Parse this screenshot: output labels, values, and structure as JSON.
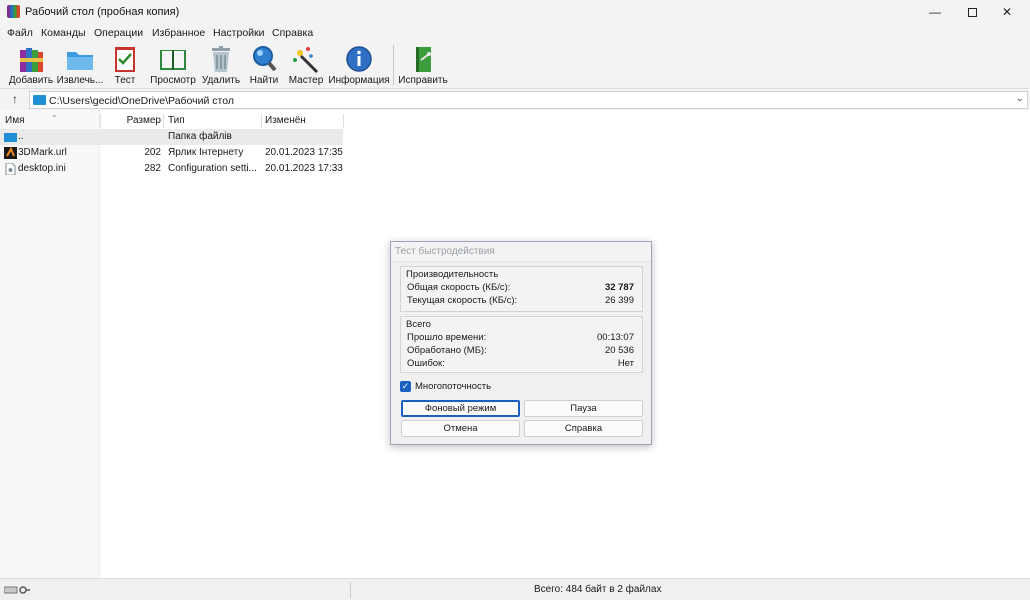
{
  "window": {
    "title": "Рабочий стол (пробная копия)",
    "controls": {
      "minimize": "—",
      "close": "✕"
    }
  },
  "menu": [
    "Файл",
    "Команды",
    "Операции",
    "Избранное",
    "Настройки",
    "Справка"
  ],
  "toolbar": [
    {
      "label": "Добавить",
      "icon": "books-stack-icon"
    },
    {
      "label": "Извлечь...",
      "icon": "folder-icon"
    },
    {
      "label": "Тест",
      "icon": "checklist-icon"
    },
    {
      "label": "Просмотр",
      "icon": "open-book-icon"
    },
    {
      "label": "Удалить",
      "icon": "trash-can-icon"
    },
    {
      "label": "Найти",
      "icon": "magnifier-icon"
    },
    {
      "label": "Мастер",
      "icon": "magic-wand-icon"
    },
    {
      "label": "Информация",
      "icon": "info-icon"
    },
    {
      "label": "Исправить",
      "icon": "repair-book-icon"
    }
  ],
  "address": {
    "up": "↑",
    "path": "C:\\Users\\gecid\\OneDrive\\Рабочий стол",
    "dropdown": "⌄"
  },
  "columns": {
    "name": "Имя",
    "size": "Размер",
    "type": "Тип",
    "modified": "Изменён"
  },
  "files": [
    {
      "name": "..",
      "size": "",
      "type": "Папка файлів",
      "modified": ""
    },
    {
      "name": "3DMark.url",
      "size": "202",
      "type": "Ярлик Інтернету",
      "modified": "20.01.2023 17:35"
    },
    {
      "name": "desktop.ini",
      "size": "282",
      "type": "Configuration setti...",
      "modified": "20.01.2023 17:33"
    }
  ],
  "status": {
    "total": "Всего: 484 байт в 2 файлах"
  },
  "dialog": {
    "title": "Тест быстродействия",
    "performance": {
      "title": "Производительность",
      "overall_label": "Общая скорость (КБ/с):",
      "overall_value": "32 787",
      "current_label": "Текущая скорость (КБ/с):",
      "current_value": "26 399"
    },
    "totals": {
      "title": "Всего",
      "elapsed_label": "Прошло времени:",
      "elapsed_value": "00:13:07",
      "processed_label": "Обработано (МБ):",
      "processed_value": "20 536",
      "errors_label": "Ошибок:",
      "errors_value": "Нет"
    },
    "multithread_label": "Многопоточность",
    "multithread_checked": true,
    "buttons": {
      "background": "Фоновый режим",
      "pause": "Пауза",
      "cancel": "Отмена",
      "help": "Справка"
    }
  }
}
